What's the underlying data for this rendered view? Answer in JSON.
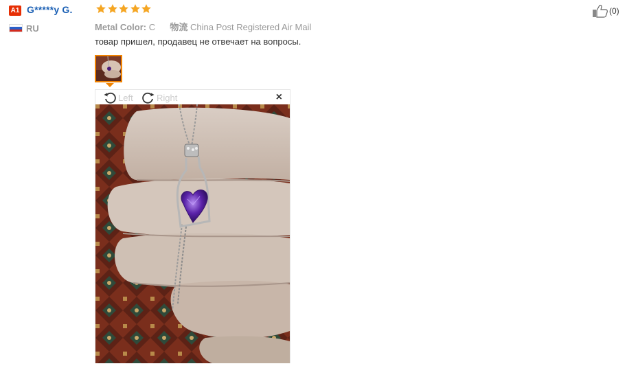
{
  "reviewer": {
    "badge": "A1",
    "name": "G*****y G.",
    "country": "RU"
  },
  "rating": {
    "stars": 5,
    "max": 5
  },
  "meta": {
    "color_label": "Metal Color:",
    "color_value": "C",
    "shipping_label": "物流",
    "shipping_value": "China Post Registered Air Mail"
  },
  "feedback_text": "товар пришел, продавец не отвечает на вопросы.",
  "viewer": {
    "rotate_left": "Left",
    "rotate_right": "Right",
    "close": "×"
  },
  "helpful": {
    "count": "(0)"
  },
  "colors": {
    "accent": "#f08200",
    "star": "#f5a623",
    "name": "#1a5fb4",
    "badge": "#e62e04"
  }
}
